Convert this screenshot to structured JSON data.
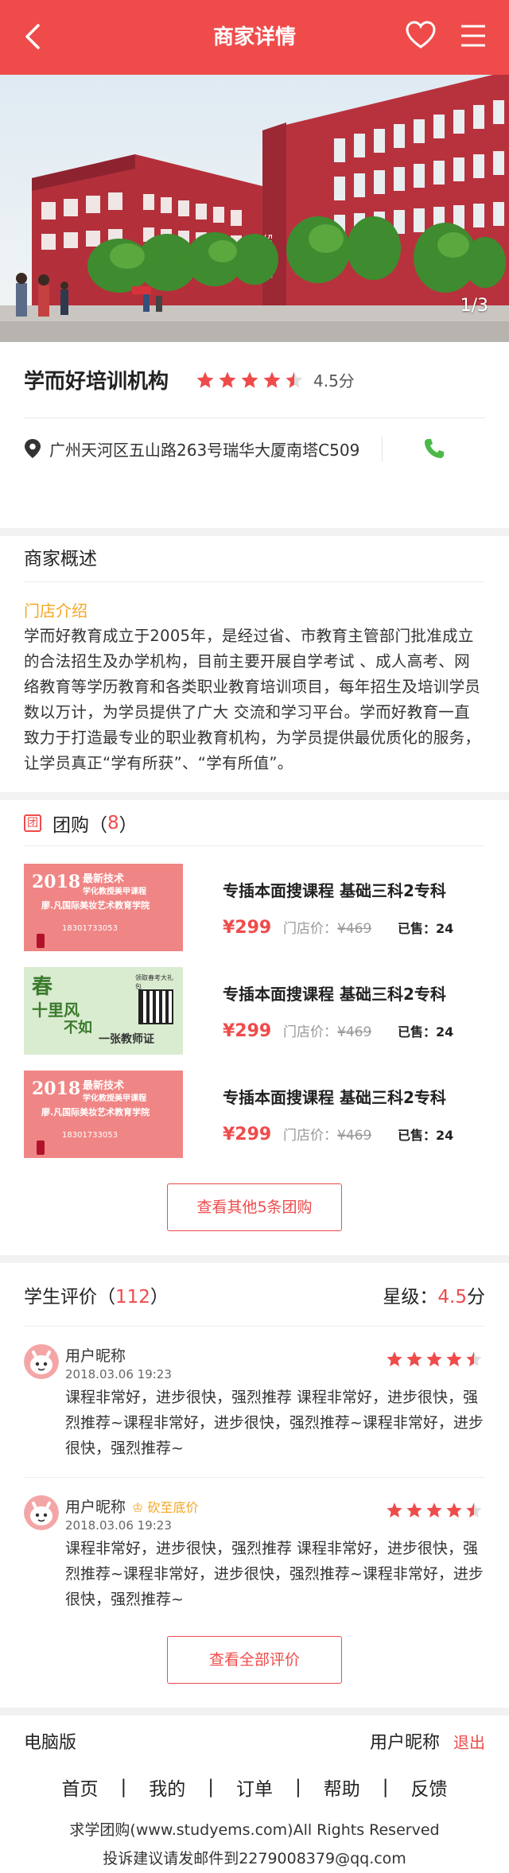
{
  "header": {
    "title": "商家详情",
    "back_icon": "back-arrow-icon",
    "fav_icon": "heart-icon",
    "menu_icon": "menu-icon"
  },
  "hero": {
    "counter": "1/3",
    "building_sign": "5号教学楼"
  },
  "shop": {
    "name": "学而好培训机构",
    "rating": 4.5,
    "rating_text": "4.5分",
    "address": "广州天河区五山路263号瑞华大厦南塔C509",
    "accent": "#ef4b4b",
    "phone_color": "#4cb848"
  },
  "overview": {
    "title": "商家概述",
    "intro_label": "门店介绍",
    "intro_text": "学而好教育成立于2005年，是经过省、市教育主管部门批准成立的合法招生及办学机构，目前主要开展自学考试 、成人高考、网络教育等学历教育和各类职业教育培训项目，每年招生及培训学员数以万计，为学员提供了广大 交流和学习平台。学而好教育一直致力于打造最专业的职业教育机构，为学员提供最优质化的服务，让学员真正“学有所获”、“学有所值”。"
  },
  "groupbuy": {
    "icon_text": "团",
    "title": "团购",
    "count_open": "（",
    "count": "8",
    "count_close": "）",
    "deals": [
      {
        "name": "专插本面搜课程 基础三科2专科",
        "price": "¥299",
        "store_label": "门店价：",
        "store_price": "¥469",
        "sold": "已售：24",
        "img_line1": "2018",
        "img_line2": "最新技术",
        "img_line3": "学化教授美甲课程",
        "img_line4": "廖.凡国际美妆艺术教育学院",
        "img_phone": "18301733053"
      },
      {
        "name": "专插本面搜课程 基础三科2专科",
        "price": "¥299",
        "store_label": "门店价：",
        "store_price": "¥469",
        "sold": "已售：24",
        "img_line1": "春",
        "img_line2": "十里风",
        "img_line3": "不如",
        "img_line4": "一张教师证",
        "img_phone": "领取春考大礼包"
      },
      {
        "name": "专插本面搜课程 基础三科2专科",
        "price": "¥299",
        "store_label": "门店价：",
        "store_price": "¥469",
        "sold": "已售：24",
        "img_line1": "2018",
        "img_line2": "最新技术",
        "img_line3": "学化教授美甲课程",
        "img_line4": "廖.凡国际美妆艺术教育学院",
        "img_phone": "18301733053"
      }
    ],
    "more_button": "查看其他5条团购"
  },
  "reviews": {
    "title": "学生评价",
    "count_open": "（",
    "count": "112",
    "count_close": "）",
    "grade_label": "星级：",
    "grade_value": "4.5",
    "grade_unit": "分",
    "items": [
      {
        "user": "用户昵称",
        "badge": "",
        "date": "2018.03.06  19:23",
        "rating": 4.5,
        "text": "课程非常好，进步很快，强烈推荐 课程非常好，进步很快，强烈推荐~课程非常好，进步很快，强烈推荐~课程非常好，进步很快，强烈推荐~"
      },
      {
        "user": "用户昵称",
        "badge": "砍至底价",
        "date": "2018.03.06  19:23",
        "rating": 4.5,
        "text": "课程非常好，进步很快，强烈推荐 课程非常好，进步很快，强烈推荐~课程非常好，进步很快，强烈推荐~课程非常好，进步很快，强烈推荐~"
      }
    ],
    "all_button": "查看全部评价"
  },
  "footer": {
    "pc_label": "电脑版",
    "user": "用户昵称",
    "logout": "退出",
    "nav": [
      "首页",
      "我的",
      "订单",
      "帮助",
      "反馈"
    ],
    "copyright": "求学团购(www.studyems.com)All Rights Reserved",
    "contact": "投诉建议请发邮件到2279008379@qq.com"
  }
}
